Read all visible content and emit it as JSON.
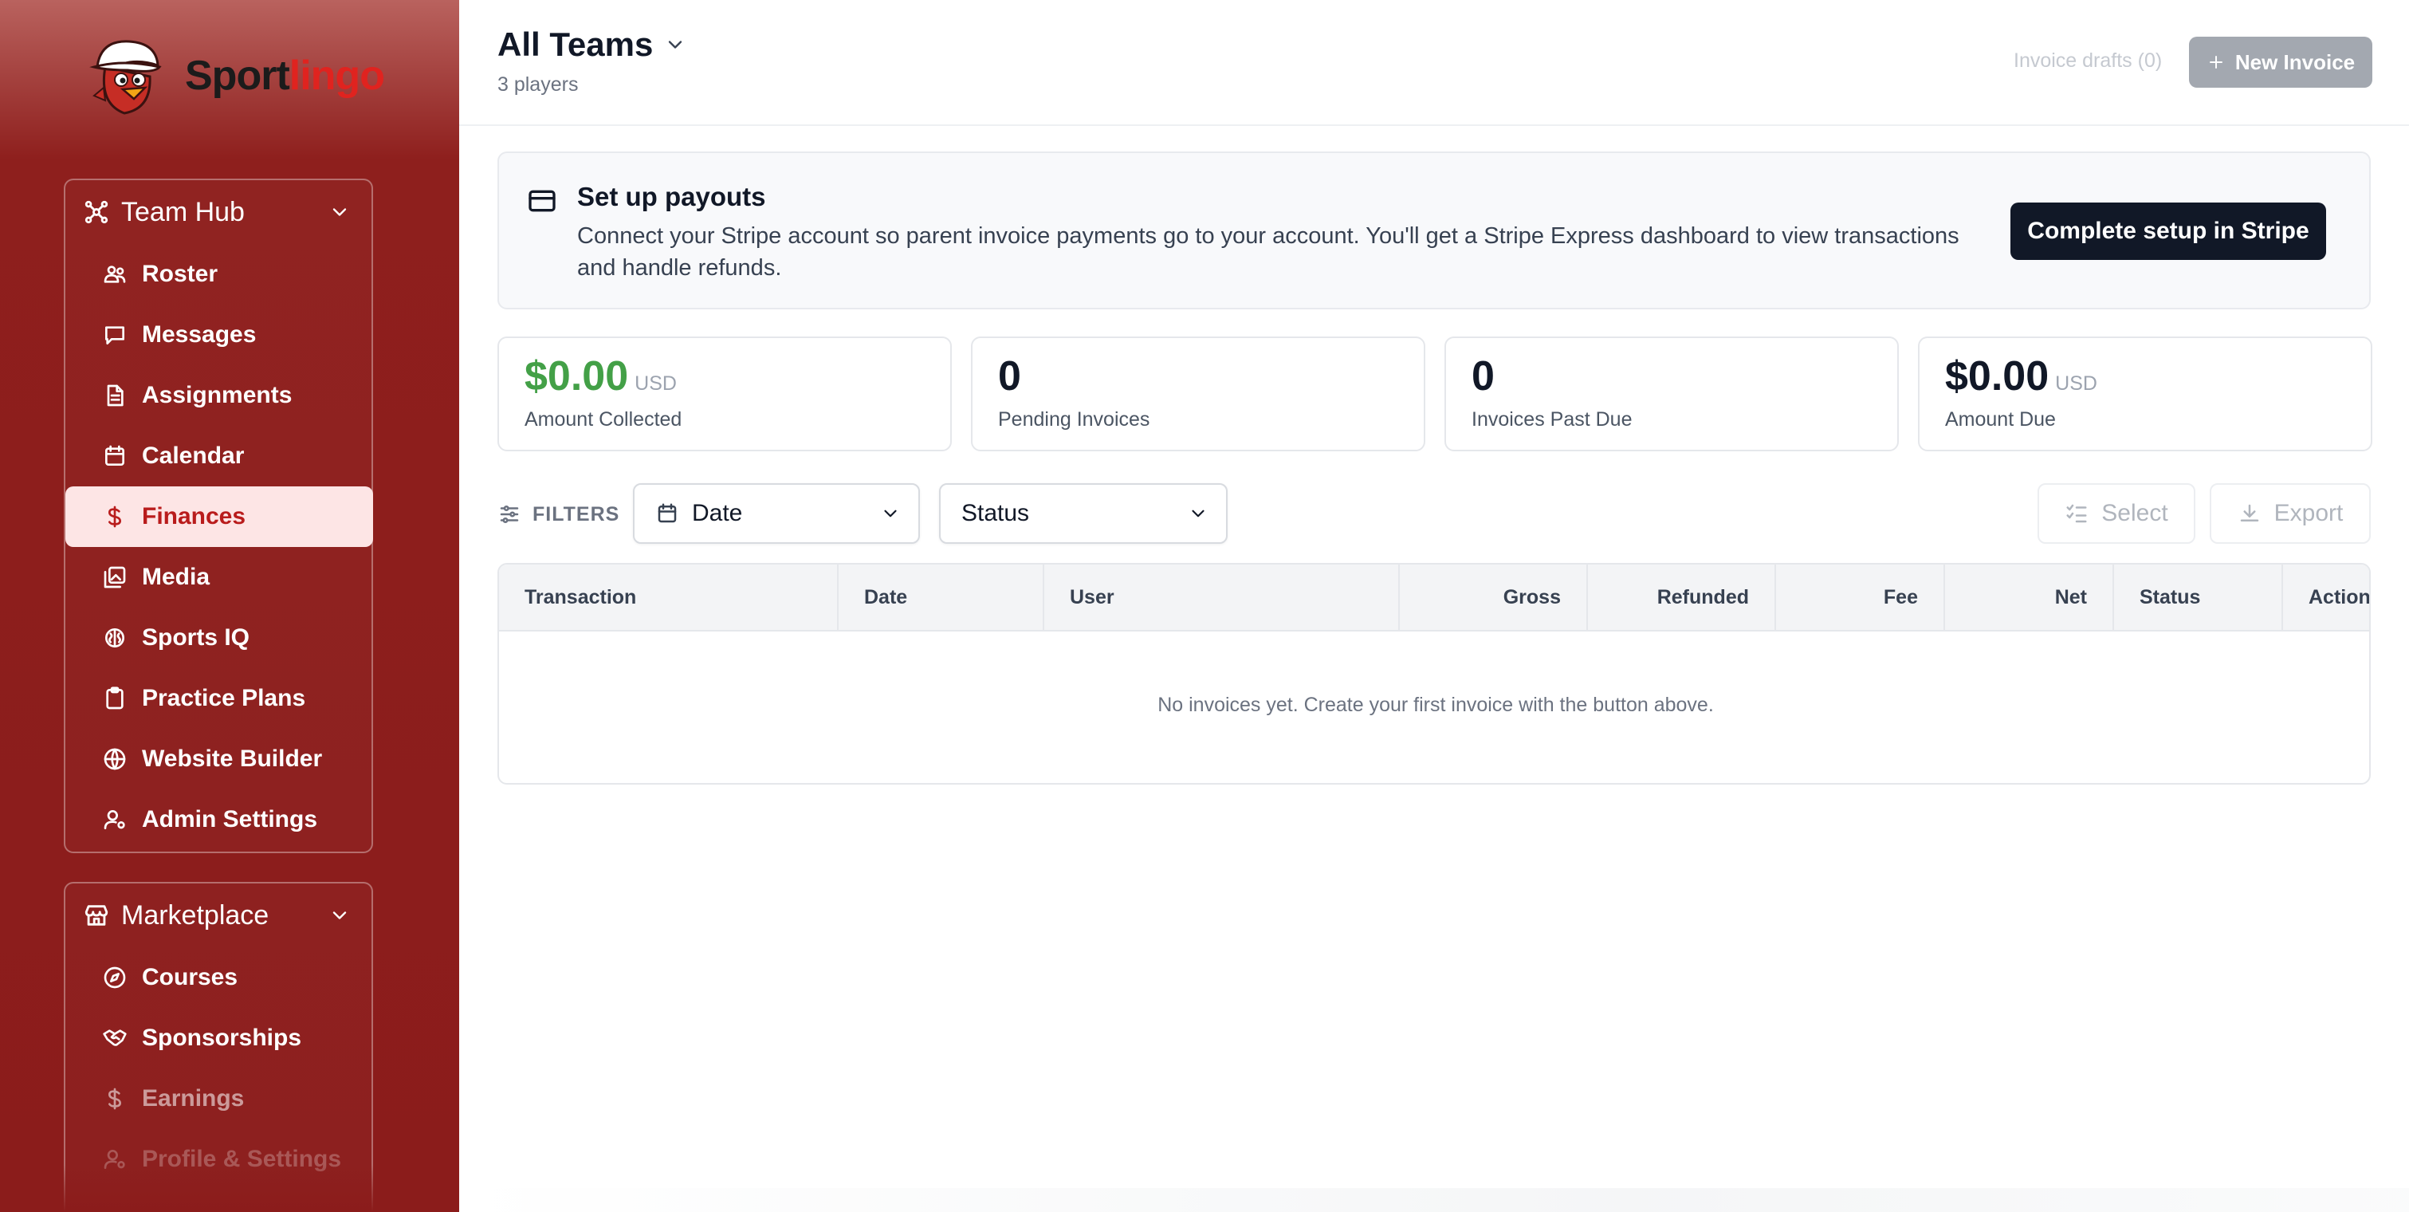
{
  "brand": {
    "name_dark": "Sport",
    "name_accent": "lingo",
    "accent_color": "#e0231f"
  },
  "sidebar": {
    "team_hub": {
      "title": "Team Hub",
      "items": [
        {
          "label": "Roster",
          "icon": "roster-icon"
        },
        {
          "label": "Messages",
          "icon": "message-icon"
        },
        {
          "label": "Assignments",
          "icon": "document-icon"
        },
        {
          "label": "Calendar",
          "icon": "calendar-icon"
        },
        {
          "label": "Finances",
          "icon": "dollar-icon",
          "active": true
        },
        {
          "label": "Media",
          "icon": "media-icon"
        },
        {
          "label": "Sports IQ",
          "icon": "brain-icon"
        },
        {
          "label": "Practice Plans",
          "icon": "clipboard-icon"
        },
        {
          "label": "Website Builder",
          "icon": "globe-icon"
        },
        {
          "label": "Admin Settings",
          "icon": "user-cog-icon"
        }
      ]
    },
    "marketplace": {
      "title": "Marketplace",
      "items": [
        {
          "label": "Courses",
          "icon": "compass-icon"
        },
        {
          "label": "Sponsorships",
          "icon": "handshake-icon"
        },
        {
          "label": "Earnings",
          "icon": "dollar-icon"
        },
        {
          "label": "Profile & Settings",
          "icon": "user-cog-icon"
        }
      ]
    }
  },
  "header": {
    "title": "All Teams",
    "subtitle": "3 players",
    "drafts_label": "Invoice drafts (0)",
    "new_invoice_label": "New Invoice"
  },
  "payout": {
    "title": "Set up payouts",
    "description": "Connect your Stripe account so parent invoice payments go to your account. You'll get a Stripe Express dashboard to view transactions and handle refunds.",
    "button_label": "Complete setup in Stripe"
  },
  "stats": [
    {
      "value": "$0.00",
      "currency": "USD",
      "label": "Amount Collected",
      "color": "#43a047"
    },
    {
      "value": "0",
      "currency": "",
      "label": "Pending Invoices"
    },
    {
      "value": "0",
      "currency": "",
      "label": "Invoices Past Due"
    },
    {
      "value": "$0.00",
      "currency": "USD",
      "label": "Amount Due"
    }
  ],
  "filters": {
    "label": "FILTERS",
    "date_label": "Date",
    "status_label": "Status",
    "select_label": "Select",
    "export_label": "Export"
  },
  "table": {
    "columns": [
      "Transaction",
      "Date",
      "User",
      "Gross",
      "Refunded",
      "Fee",
      "Net",
      "Status",
      "Action"
    ],
    "empty_message": "No invoices yet. Create your first invoice with the button above."
  }
}
